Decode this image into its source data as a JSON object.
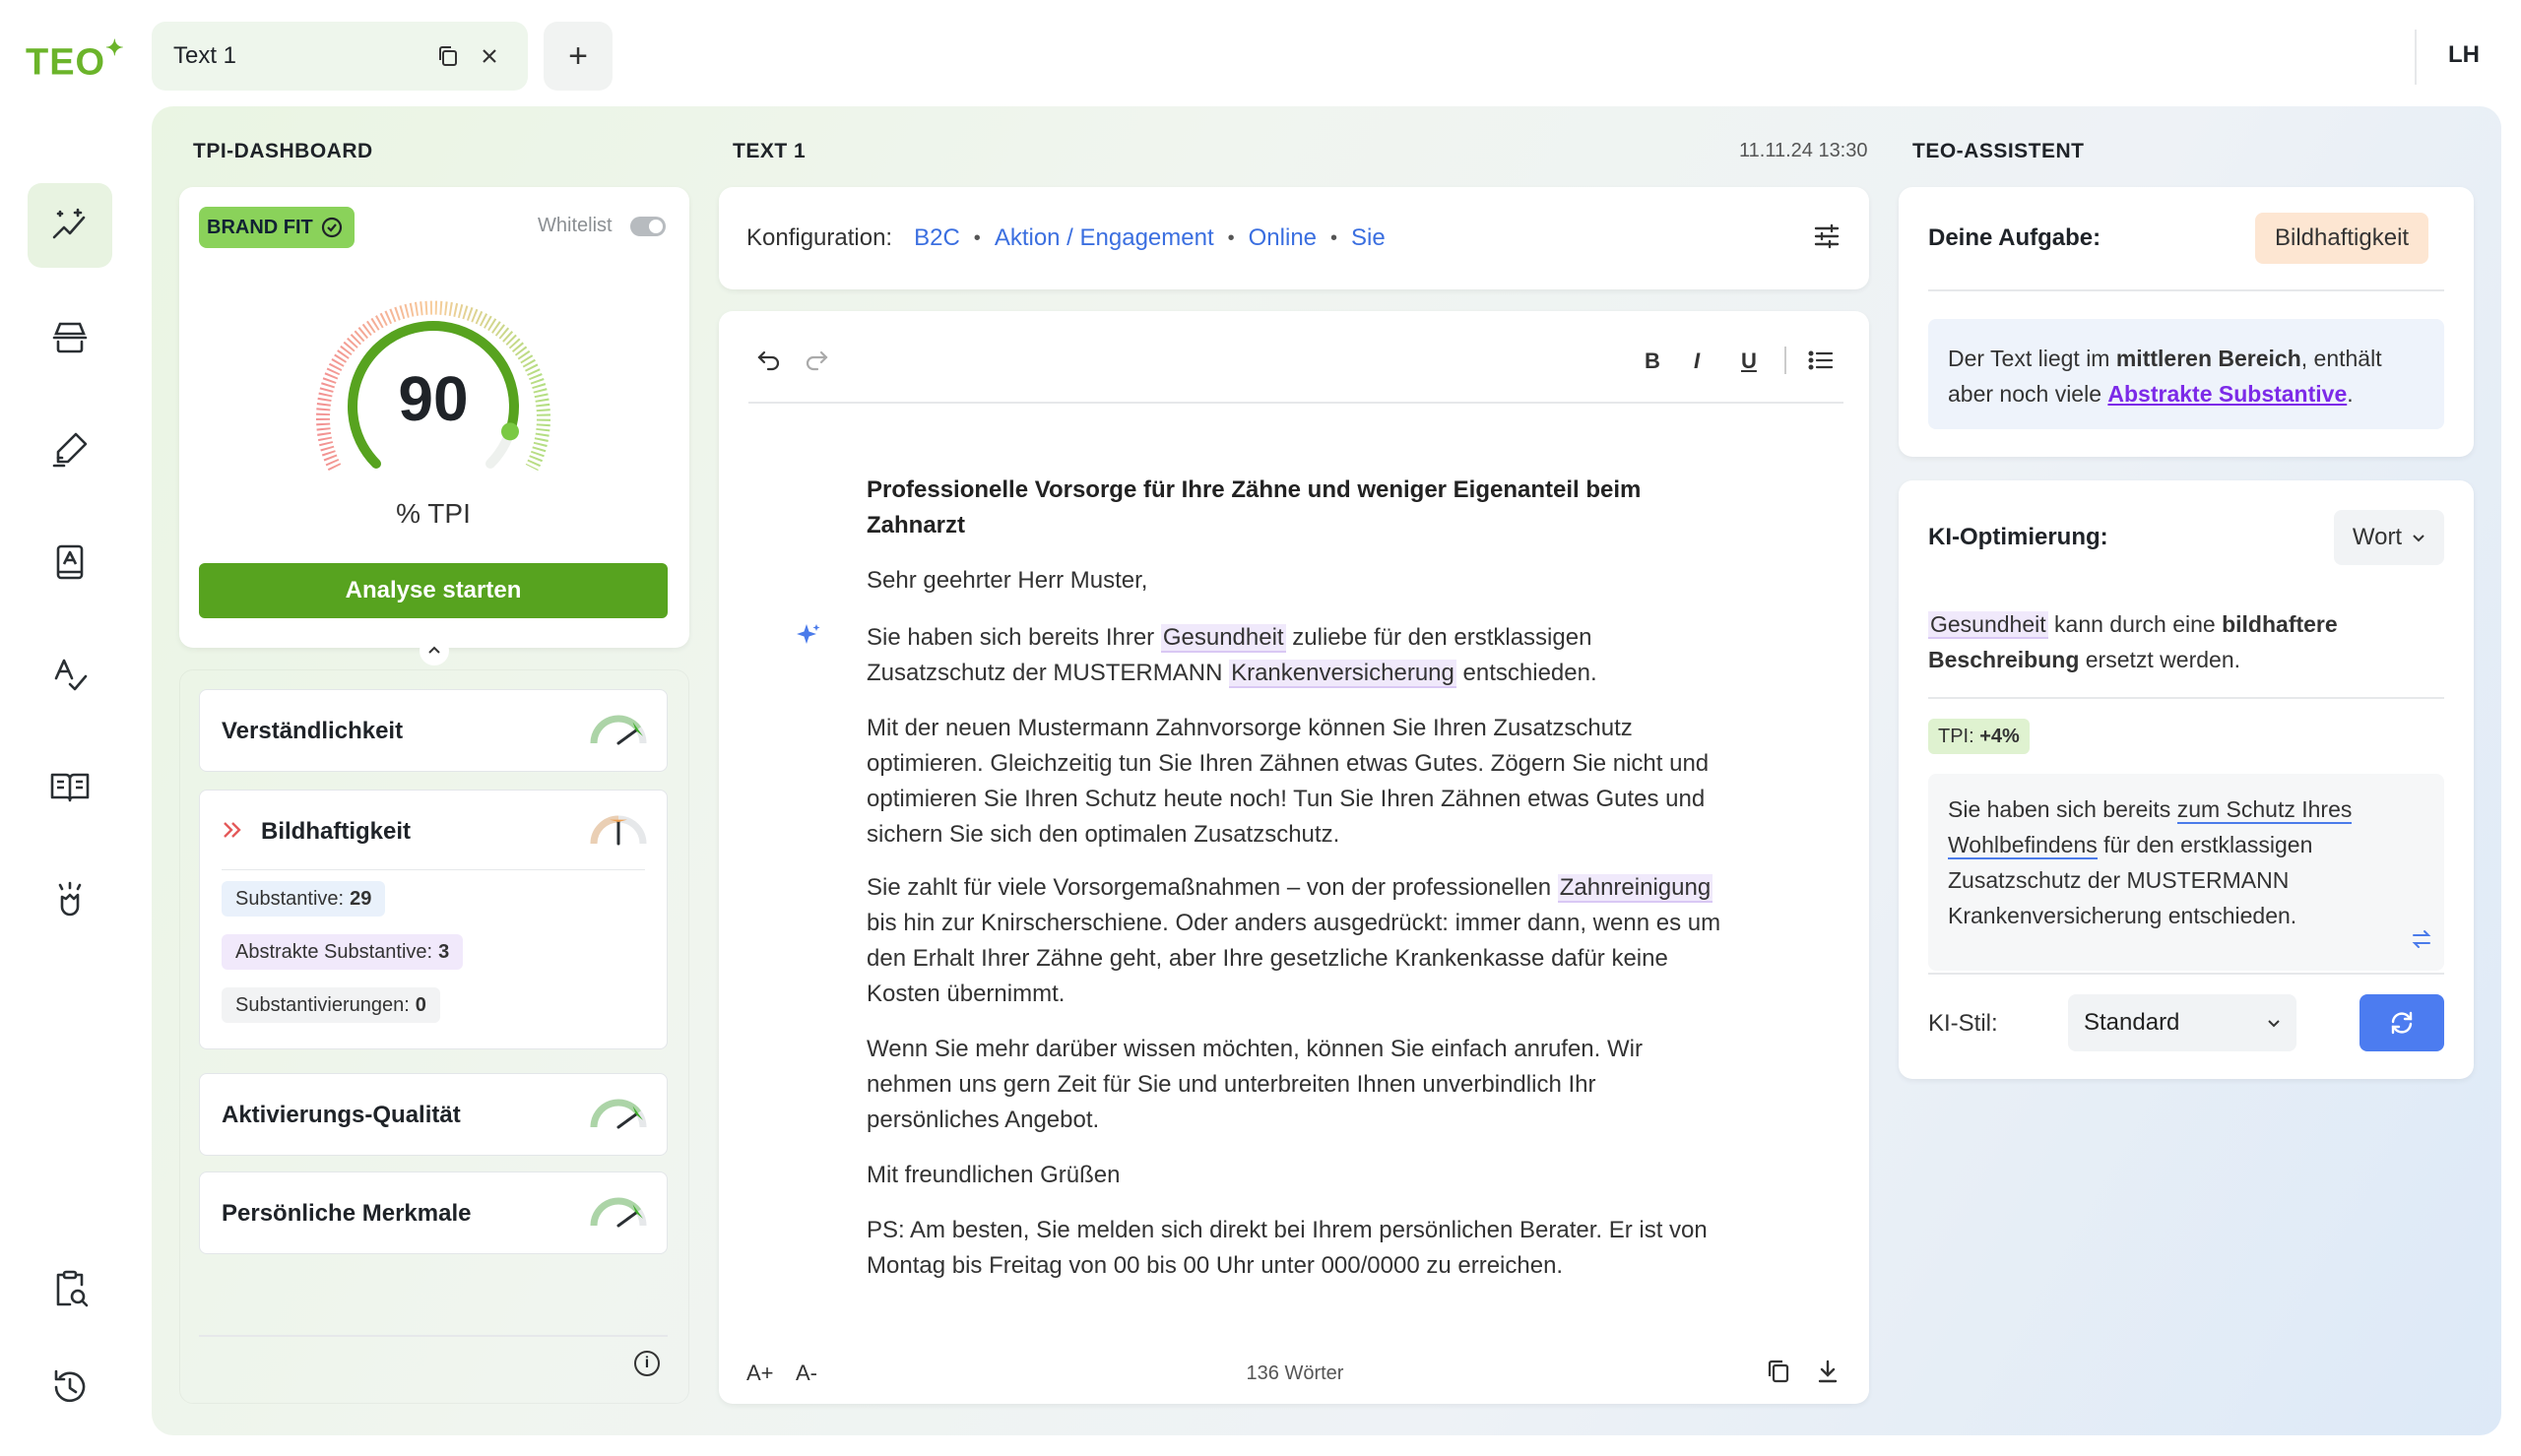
{
  "app": {
    "logo": "TEO",
    "logo_mark": "✦"
  },
  "tabs": {
    "active_label": "Text 1",
    "add_label": "+"
  },
  "user": {
    "initials": "LH"
  },
  "dashboard": {
    "title": "TPI-DASHBOARD",
    "brand_fit": "BRAND FIT",
    "whitelist_label": "Whitelist",
    "score": "90",
    "score_value": 90,
    "score_unit": "% TPI",
    "analyse_button": "Analyse starten",
    "metrics": [
      {
        "label": "Verständlichkeit",
        "level": 0.8
      },
      {
        "label": "Bildhaftigkeit",
        "level": 0.5
      },
      {
        "label": "Aktivierungs-Qualität",
        "level": 0.8
      },
      {
        "label": "Persönliche Merkmale",
        "level": 0.8
      }
    ],
    "chips": [
      {
        "label": "Substantive:",
        "value": "29",
        "color": "#e9f1fb"
      },
      {
        "label": "Abstrakte Substantive:",
        "value": "3",
        "color": "#f1e9fb"
      },
      {
        "label": "Substantivierungen:",
        "value": "0",
        "color": "#f2f3f4"
      }
    ]
  },
  "editor": {
    "title": "TEXT 1",
    "timestamp": "11.11.24 13:30",
    "config_label": "Konfiguration:",
    "config": [
      "B2C",
      "Aktion / Engagement",
      "Online",
      "Sie"
    ],
    "separator": "•",
    "toolbar": {
      "bold": "B",
      "italic": "I",
      "underline": "U"
    },
    "heading": "Professionelle Vorsorge für Ihre Zähne und weniger Eigenanteil beim Zahnarzt",
    "salutation": "Sehr geehrter Herr Muster,",
    "p1": {
      "a": "Sie haben sich bereits Ihrer ",
      "h1": "Gesundheit",
      "b": " zuliebe für den erstklassigen Zusatzschutz der MUSTERMANN ",
      "h2": "Krankenversicherung",
      "c": " entschieden."
    },
    "p2": "Mit der neuen Mustermann Zahnvorsorge können Sie Ihren Zusatzschutz optimieren. Gleichzeitig tun Sie Ihren Zähnen etwas Gutes. Zögern Sie nicht und optimieren Sie Ihren Schutz heute noch! Tun Sie Ihren Zähnen etwas Gutes und sichern Sie sich den optimalen Zusatzschutz.",
    "p3": {
      "a": "Sie zahlt für viele Vorsorgemaßnahmen – von der professionellen ",
      "h1": "Zahnreinigung",
      "b": " bis hin zur Knirscherschiene. Oder anders ausgedrückt: immer dann, wenn es um den Erhalt Ihrer Zähne geht, aber Ihre gesetzliche Krankenkasse dafür keine Kosten übernimmt."
    },
    "p4": "Wenn Sie mehr darüber wissen möchten, können Sie einfach anrufen. Wir nehmen uns gern Zeit für Sie und unterbreiten Ihnen unverbindlich Ihr persönliches Angebot.",
    "closing": "Mit freundlichen Grüßen",
    "ps": "PS: Am besten, Sie melden sich direkt bei Ihrem persönlichen Berater. Er ist von Montag bis Freitag von 00 bis 00 Uhr unter 000/0000 zu erreichen.",
    "font_up": "A+",
    "font_down": "A-",
    "word_count": "136 Wörter"
  },
  "assistant": {
    "title": "TEO-ASSISTENT",
    "task_label": "Deine Aufgabe:",
    "task_value": "Bildhaftigkeit",
    "hint": {
      "a": "Der Text liegt im ",
      "b": "mittleren Bereich",
      "c": ", enthält aber noch viele ",
      "link": "Abstrakte Substantive",
      "d": "."
    },
    "ki_label": "KI-Optimierung:",
    "ki_mode": "Wort",
    "suggestion_intro": {
      "word": "Gesundheit",
      "a": " kann durch eine ",
      "b": "bildhaftere Beschreibung",
      "c": " ersetzt werden."
    },
    "tpi_prefix": "TPI:",
    "tpi_gain": "+4%",
    "suggestion": {
      "a": "Sie haben sich bereits ",
      "u": "zum Schutz Ihres Wohlbefindens",
      "b": " für den erstklassigen Zusatzschutz der MUSTERMANN Krankenversicherung entschieden."
    },
    "stil_label": "KI-Stil:",
    "stil_value": "Standard"
  },
  "colors": {
    "brand_green": "#57a31f",
    "link_blue": "#3b6fe0",
    "accent_purple": "#7c2ae8",
    "button_blue": "#4c7cf0"
  }
}
